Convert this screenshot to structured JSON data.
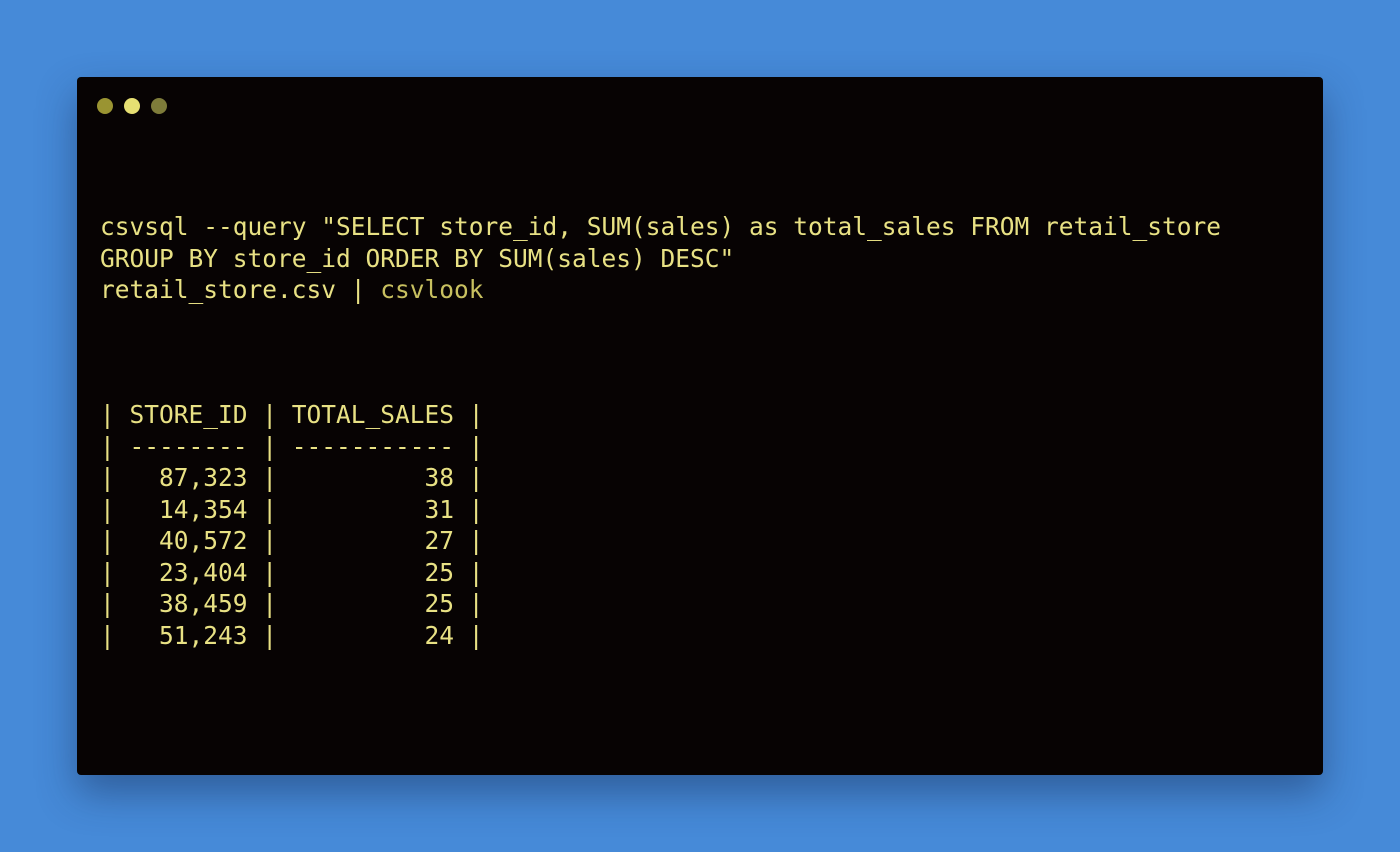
{
  "window": {
    "controls": [
      "close",
      "minimize",
      "maximize"
    ]
  },
  "command": {
    "line1": "csvsql --query \"SELECT store_id, SUM(sales) as total_sales FROM retail_store",
    "line2": "GROUP BY store_id ORDER BY SUM(sales) DESC\"",
    "line3_file": "retail_store.csv | ",
    "line3_pipe_cmd": "csvlook"
  },
  "table": {
    "headers": [
      "STORE_ID",
      "TOTAL_SALES"
    ],
    "separators": [
      "--------",
      "-----------"
    ],
    "rows": [
      {
        "store_id": "87,323",
        "total_sales": "38"
      },
      {
        "store_id": "14,354",
        "total_sales": "31"
      },
      {
        "store_id": "40,572",
        "total_sales": "27"
      },
      {
        "store_id": "23,404",
        "total_sales": "25"
      },
      {
        "store_id": "38,459",
        "total_sales": "25"
      },
      {
        "store_id": "51,243",
        "total_sales": "24"
      }
    ]
  },
  "colors": {
    "background": "#468ad8",
    "terminal": "#070303",
    "text": "#e8e184"
  }
}
